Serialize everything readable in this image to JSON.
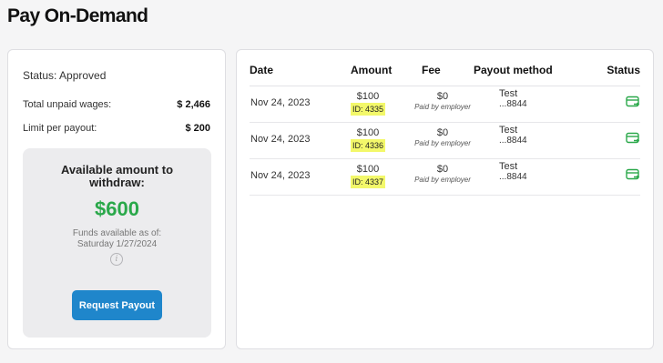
{
  "page": {
    "title": "Pay On-Demand"
  },
  "summary": {
    "status": "Status: Approved",
    "total_unpaid_label": "Total unpaid wages:",
    "total_unpaid_value": "$ 2,466",
    "limit_label": "Limit per payout:",
    "limit_value": "$ 200"
  },
  "available": {
    "title": "Available amount to withdraw:",
    "amount": "$600",
    "note": "Funds available as of: Saturday 1/27/2024",
    "button_label": "Request Payout"
  },
  "table": {
    "headers": {
      "date": "Date",
      "amount": "Amount",
      "fee": "Fee",
      "payout": "Payout method",
      "status": "Status"
    },
    "rows": [
      {
        "date": "Nov 24, 2023",
        "amount": "$100",
        "id": "ID: 4335",
        "fee": "$0",
        "fee_note": "Paid by employer",
        "payout_name": "Test",
        "payout_acct": "...8844",
        "status_icon": "card-transfer-icon"
      },
      {
        "date": "Nov 24, 2023",
        "amount": "$100",
        "id": "ID: 4336",
        "fee": "$0",
        "fee_note": "Paid by employer",
        "payout_name": "Test",
        "payout_acct": "...8844",
        "status_icon": "card-transfer-icon"
      },
      {
        "date": "Nov 24, 2023",
        "amount": "$100",
        "id": "ID: 4337",
        "fee": "$0",
        "fee_note": "Paid by employer",
        "payout_name": "Test",
        "payout_acct": "...8844",
        "status_icon": "card-transfer-icon"
      }
    ]
  },
  "colors": {
    "accent_green": "#2aa84a",
    "button_blue": "#1f86cb",
    "highlight_yellow": "#f3f86a"
  }
}
